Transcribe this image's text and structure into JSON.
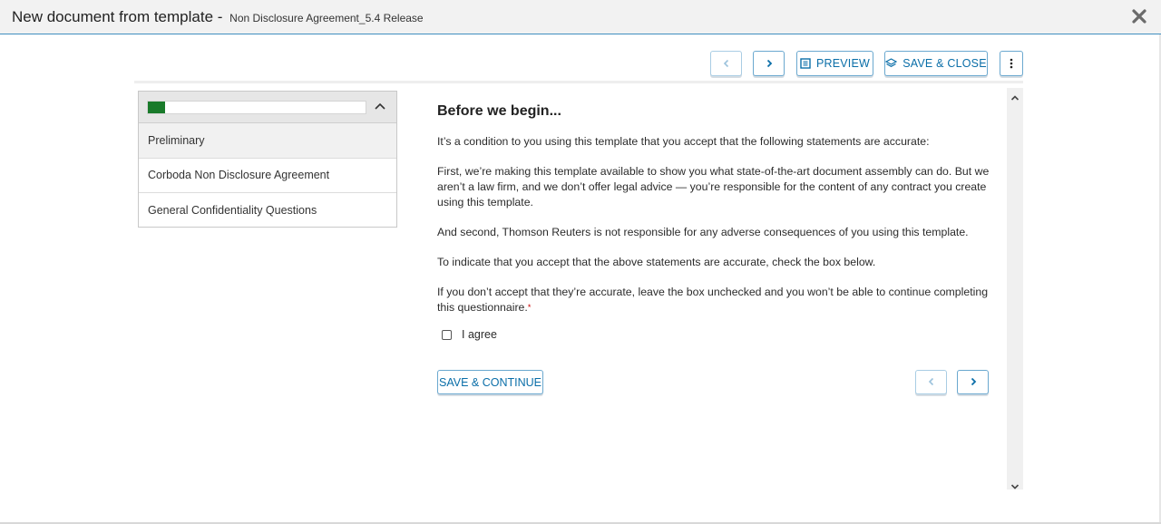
{
  "window": {
    "title": "New document from template -",
    "subtitle": "Non Disclosure Agreement_5.4 Release",
    "close_icon": "close-icon"
  },
  "toolbar": {
    "prev_icon": "chevron-left-icon",
    "next_icon": "chevron-right-icon",
    "preview_label": "PREVIEW",
    "preview_icon": "document-preview-icon",
    "save_close_label": "SAVE & CLOSE",
    "save_close_icon": "layers-icon",
    "more_icon": "kebab-menu-icon"
  },
  "sidebar": {
    "progress": 0.08,
    "progress_color": "#197a2a",
    "collapse_icon": "chevron-up-icon",
    "items": [
      {
        "label": "Preliminary",
        "active": true
      },
      {
        "label": "Corboda Non Disclosure Agreement",
        "active": false
      },
      {
        "label": "General Confidentiality Questions",
        "active": false
      }
    ]
  },
  "content": {
    "heading": "Before we begin...",
    "paragraphs": [
      "It’s a condition to you using this template that you accept that the following statements are accurate:",
      "First, we’re making this template available to show you what state-of-the-art document assembly can do. But we aren’t a law firm, and we don’t offer legal advice — you’re responsible for the content of any contract you create using this template.",
      "And second, Thomson Reuters is not responsible for any adverse consequences of you using this template.",
      "To indicate that you accept that the above statements are accurate, check the box below.",
      "If you don’t accept that they’re accurate, leave the box unchecked and you won’t be able to continue completing this questionnaire."
    ],
    "required_mark": "*",
    "checkbox_label": "I agree",
    "checkbox_checked": false
  },
  "footer": {
    "save_continue_label": "SAVE & CONTINUE",
    "prev_icon": "chevron-left-icon",
    "next_icon": "chevron-right-icon"
  },
  "colors": {
    "accent": "#0a6ea8",
    "button_border": "#6aa8cf",
    "progress": "#197a2a"
  }
}
